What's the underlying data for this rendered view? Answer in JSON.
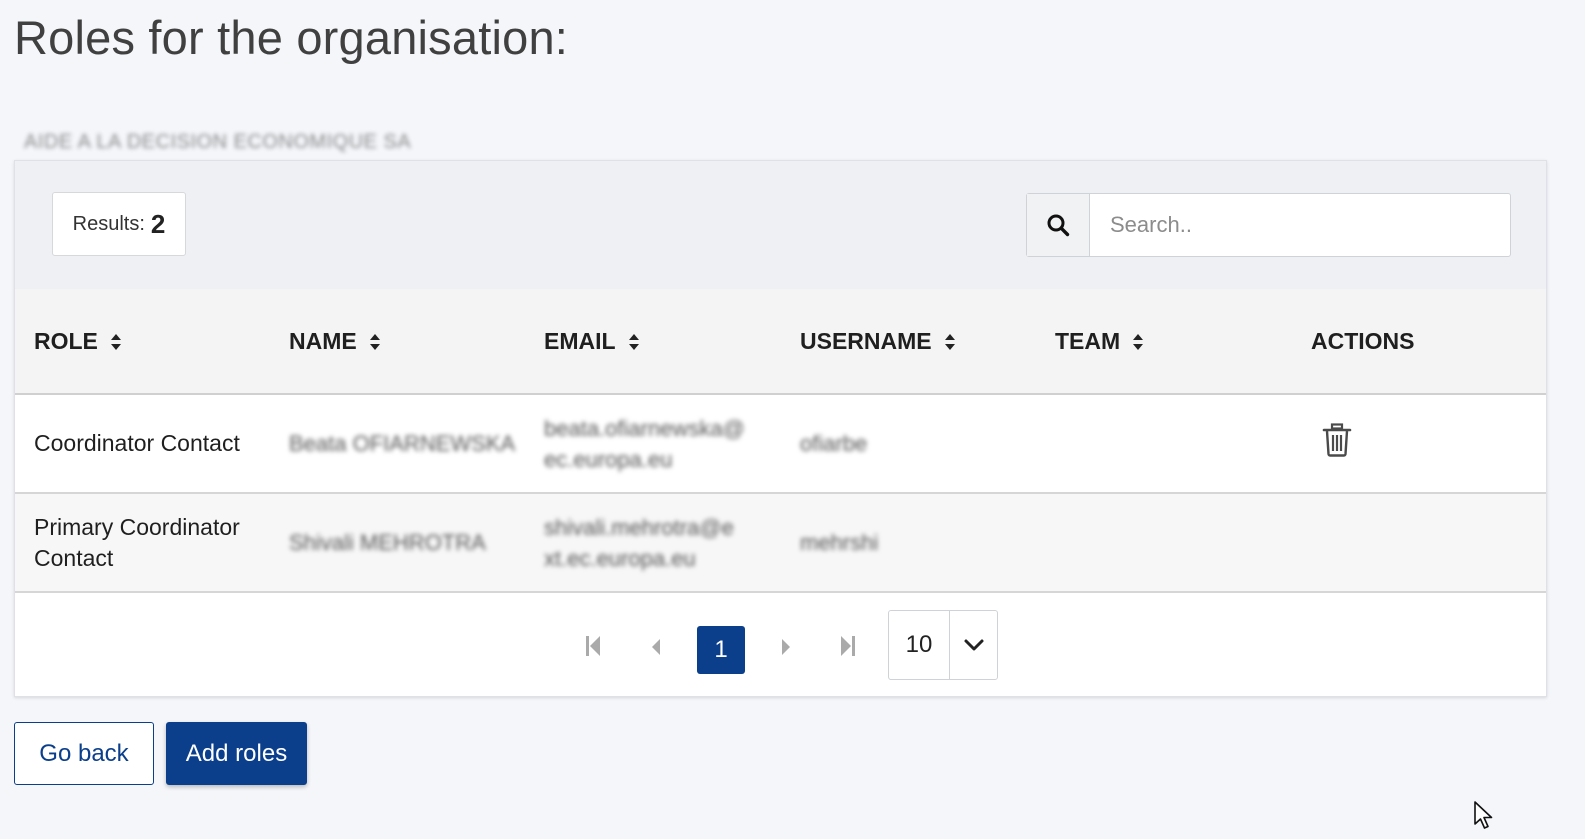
{
  "page": {
    "title": "Roles for the organisation:",
    "organisation_name": "AIDE A LA DECISION ECONOMIQUE SA"
  },
  "toolbar": {
    "results_label": "Results:",
    "results_count": "2",
    "search_placeholder": "Search.."
  },
  "table": {
    "headers": {
      "role": "ROLE",
      "name": "NAME",
      "email": "EMAIL",
      "username": "USERNAME",
      "team": "TEAM",
      "actions": "ACTIONS"
    },
    "rows": [
      {
        "role": "Coordinator Contact",
        "name": "Beata OFIARNEWSKA",
        "email_line1": "beata.ofiarnewska@",
        "email_line2": "ec.europa.eu",
        "username": "ofiarbe",
        "team": "",
        "action_icon": "trash-icon"
      },
      {
        "role_line1": "Primary Coordinator",
        "role_line2": "Contact",
        "name": "Shivali MEHROTRA",
        "email_line1": "shivali.mehrotra@e",
        "email_line2": "xt.ec.europa.eu",
        "username": "mehrshi",
        "team": ""
      }
    ]
  },
  "pagination": {
    "current_page": "1",
    "page_size": "10"
  },
  "buttons": {
    "go_back": "Go back",
    "add_roles": "Add roles"
  },
  "colors": {
    "primary": "#0b3f8c",
    "background": "#f4f6fa",
    "toolbar_bg": "#eef0f3"
  }
}
